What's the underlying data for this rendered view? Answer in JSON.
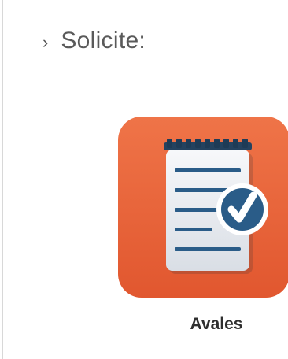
{
  "section": {
    "chevron": "›",
    "title": "Solicite:"
  },
  "tiles": [
    {
      "label": "Avales",
      "icon": "notepad-checklist-icon",
      "colors": {
        "tile": "#e8663f",
        "paper": "#e9ecf0",
        "lines": "#2a5c88",
        "check_badge": "#2a5c88"
      }
    }
  ]
}
